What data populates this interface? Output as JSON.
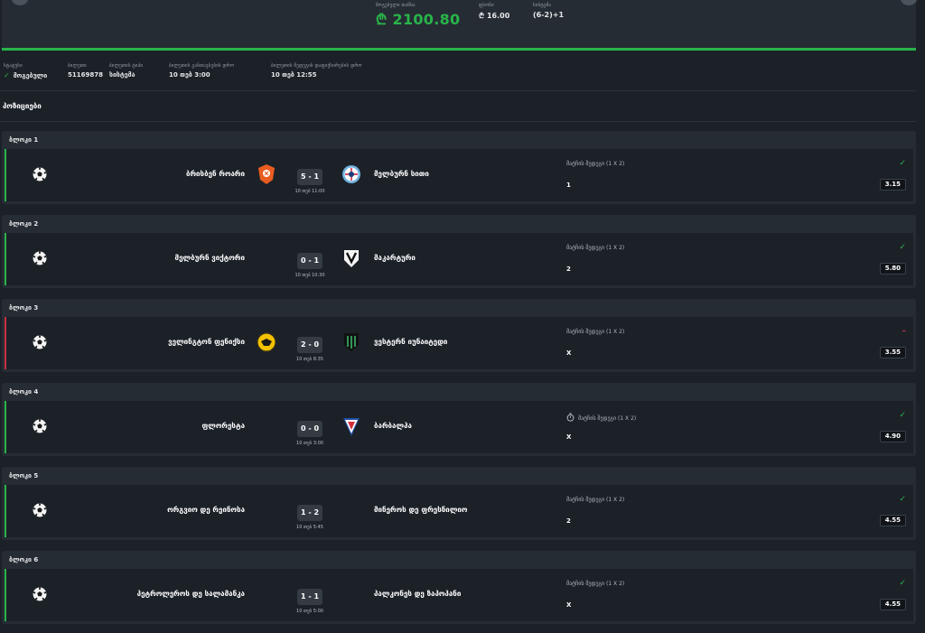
{
  "summary": {
    "possible_win_label": "მოგებული თანხა",
    "possible_win": "₾ 2100.80",
    "stake_label": "ფსონი",
    "stake": "₾ 16.00",
    "system_label": "სისტემა",
    "system": "(6-2)+1"
  },
  "info": {
    "status_label": "სტატუსი",
    "status": "მოგებული",
    "ticket_label": "ბილეთი",
    "ticket": "51169878",
    "ticket_type_label": "ბილეთის ტიპი",
    "ticket_type": "სისტემა",
    "placed_label": "ბილეთის განთავსების დრო",
    "placed": "10 თებ 3:00",
    "settled_label": "ბილეთის შედეგის დაფიქსირების დრო",
    "settled": "10 თებ 12:55"
  },
  "section_title": "პოზიციები",
  "blocks": [
    {
      "title": "ბლოკი 1",
      "home": "ბრისბენ როარი",
      "away": "მელბურნ სითი",
      "score": "5 - 1",
      "time": "10 თებ 11:00",
      "market": "მატჩის შედეგი (1 X 2)",
      "pick": "1",
      "odds": "3.15",
      "result": "win",
      "status_icon": "✓"
    },
    {
      "title": "ბლოკი 2",
      "home": "მელბურნ ვიქტორი",
      "away": "მაკარტური",
      "score": "0 - 1",
      "time": "10 თებ 10:30",
      "market": "მატჩის შედეგი (1 X 2)",
      "pick": "2",
      "odds": "5.80",
      "result": "win",
      "status_icon": "✓"
    },
    {
      "title": "ბლოკი 3",
      "home": "ველინგტონ ფენიქსი",
      "away": "ვესტერნ იუნაიტედი",
      "score": "2 - 0",
      "time": "10 თებ 8:35",
      "market": "მატჩის შედეგი (1 X 2)",
      "pick": "X",
      "odds": "3.55",
      "result": "lose",
      "status_icon": "–"
    },
    {
      "title": "ბლოკი 4",
      "home": "ფლორესტა",
      "away": "ბარბალჰა",
      "score": "0 - 0",
      "time": "10 თებ 3:00",
      "market": "მატჩის შედეგი (1 X 2)",
      "pick": "X",
      "odds": "4.90",
      "result": "win",
      "status_icon": "✓",
      "timer": true
    },
    {
      "title": "ბლოკი 5",
      "home": "ორგვიო დე რეინოსა",
      "away": "მინეროს დე ფრესნილიო",
      "score": "1 - 2",
      "time": "10 თებ 5:45",
      "market": "მატჩის შედეგი (1 X 2)",
      "pick": "2",
      "odds": "4.55",
      "result": "win",
      "status_icon": "✓"
    },
    {
      "title": "ბლოკი 6",
      "home": "პეტროლეროს დე სალამანკა",
      "away": "პალკონეს დე ზაპოპანი",
      "score": "1 - 1",
      "time": "10 თებ 5:00",
      "market": "მატჩის შედეგი (1 X 2)",
      "pick": "X",
      "odds": "4.55",
      "result": "win",
      "status_icon": "✓"
    }
  ],
  "colors": {
    "accent": "#28b44a",
    "lose": "#c63042",
    "background": "#1c2128",
    "card": "#262c33"
  }
}
